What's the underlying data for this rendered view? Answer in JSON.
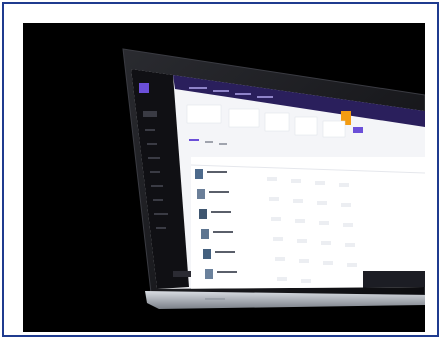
{
  "photo": {
    "subject": "laptop-dashboard-mockup",
    "colors": {
      "frame_border": "#1f3b8f",
      "background": "#000000",
      "screen_bg": "#f4f5f8",
      "sidebar_bg": "#101014",
      "header_bg": "#2a1f5c",
      "accent_orange": "#f39c12",
      "accent_purple": "#6b4fd8"
    },
    "icons": [
      "laptop-icon"
    ]
  }
}
